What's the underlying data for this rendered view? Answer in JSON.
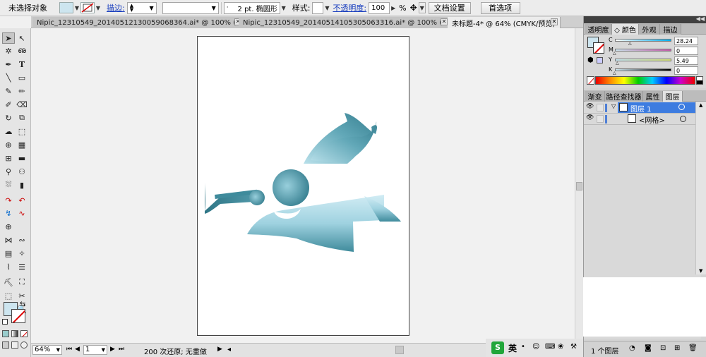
{
  "control_bar": {
    "selection_status": "未选择对象",
    "stroke_label": "描边:",
    "stroke_weight": "",
    "brush_value": "",
    "profile_value": "2 pt. 椭圆形",
    "style_label": "样式:",
    "opacity_label": "不透明度:",
    "opacity_value": "100",
    "opacity_unit": "%",
    "doc_setup_button": "文档设置",
    "preferences_button": "首选项",
    "fill_color": "#cde5ef"
  },
  "document_tabs": [
    {
      "label": "Nipic_12310549_20140512130059068364.ai* @ 100% (R...",
      "active": false
    },
    {
      "label": "Nipic_12310549_20140514105305063316.ai* @ 100% (R...",
      "active": false
    },
    {
      "label": "未标题-4* @ 64% (CMYK/预览)",
      "active": true
    }
  ],
  "color_panel": {
    "tabs": [
      {
        "label": "透明度",
        "active": false
      },
      {
        "label": "◇ 颜色",
        "active": true
      },
      {
        "label": "外观",
        "active": false
      },
      {
        "label": "描边",
        "active": false
      }
    ],
    "channels": [
      {
        "label": "C",
        "value": "28.24",
        "color": "#00aeef",
        "fraction": 0.2824
      },
      {
        "label": "M",
        "value": "0",
        "color": "#ec008c",
        "fraction": 0
      },
      {
        "label": "Y",
        "value": "5.49",
        "color": "#f7e600",
        "fraction": 0.0549
      },
      {
        "label": "K",
        "value": "0",
        "color": "#000000",
        "fraction": 0
      }
    ]
  },
  "layers_panel": {
    "tabs": [
      {
        "label": "渐变",
        "active": false
      },
      {
        "label": "路径查找器",
        "active": false
      },
      {
        "label": "属性",
        "active": false
      },
      {
        "label": "图层",
        "active": true
      }
    ],
    "layers": [
      {
        "name": "图层 1",
        "selected": true
      },
      {
        "name": "<网格>",
        "selected": false
      }
    ],
    "footer_count": "1 个图层"
  },
  "status_bar": {
    "zoom": "64%",
    "page": "1",
    "undo_status": "200 次还原; 无重做"
  },
  "taskbar": {
    "ime_logo": "S",
    "ime_mode": "英"
  },
  "colors": {
    "angel_dark": "#347d8e",
    "angel_light": "#bde3ee",
    "layer_highlight": "#3d7ce0"
  }
}
